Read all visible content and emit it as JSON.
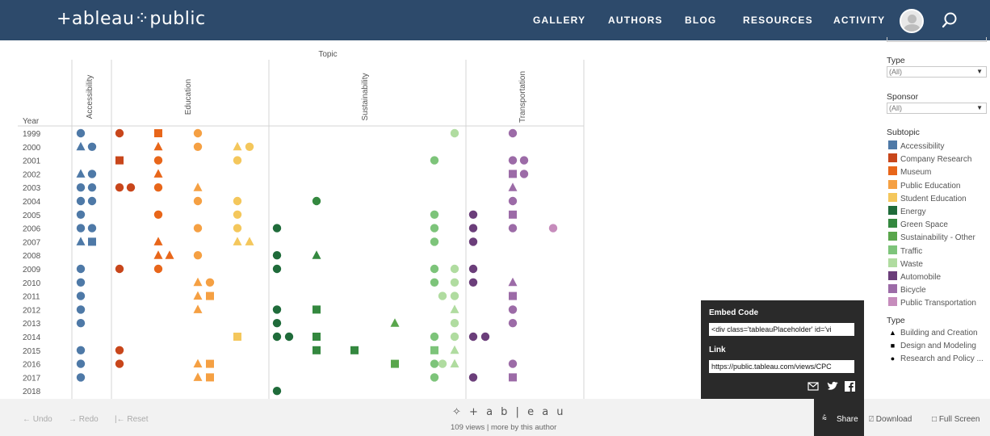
{
  "nav": {
    "logo": "+ableau⁘public",
    "items": [
      "GALLERY",
      "AUTHORS",
      "BLOG",
      "RESOURCES",
      "ACTIVITY"
    ]
  },
  "chart_data": {
    "type": "scatter",
    "title": "Topic",
    "row_header": "Year",
    "years": [
      "1999",
      "2000",
      "2001",
      "2002",
      "2003",
      "2004",
      "2005",
      "2006",
      "2007",
      "2008",
      "2009",
      "2010",
      "2011",
      "2012",
      "2013",
      "2014",
      "2015",
      "2016",
      "2017",
      "2018"
    ],
    "topics": [
      "Accessibility",
      "Education",
      "Sustainability",
      "Transportation"
    ],
    "subtopic_colors": {
      "Accessibility": "#4e79a7",
      "Company Research": "#c8461b",
      "Museum": "#e8661a",
      "Public Education": "#f5a043",
      "Student Education": "#f4c75c",
      "Energy": "#1f6b3a",
      "Green Space": "#34883f",
      "Sustainability - Other": "#59a64c",
      "Traffic": "#7dc47a",
      "Waste": "#b0dca0",
      "Automobile": "#6b3e7a",
      "Bicycle": "#9c6ba7",
      "Public Transportation": "#c68cbc"
    },
    "marks": [
      {
        "year": "1999",
        "subtopic": "Accessibility",
        "type": "circle",
        "col": 0
      },
      {
        "year": "2000",
        "subtopic": "Accessibility",
        "type": "triangle",
        "col": 0
      },
      {
        "year": "2000",
        "subtopic": "Accessibility",
        "type": "circle",
        "col": 1
      },
      {
        "year": "2002",
        "subtopic": "Accessibility",
        "type": "triangle",
        "col": 0
      },
      {
        "year": "2002",
        "subtopic": "Accessibility",
        "type": "circle",
        "col": 1
      },
      {
        "year": "2003",
        "subtopic": "Accessibility",
        "type": "circle",
        "col": 0
      },
      {
        "year": "2003",
        "subtopic": "Accessibility",
        "type": "circle",
        "col": 1
      },
      {
        "year": "2004",
        "subtopic": "Accessibility",
        "type": "circle",
        "col": 0
      },
      {
        "year": "2004",
        "subtopic": "Accessibility",
        "type": "circle",
        "col": 1
      },
      {
        "year": "2005",
        "subtopic": "Accessibility",
        "type": "circle",
        "col": 0
      },
      {
        "year": "2006",
        "subtopic": "Accessibility",
        "type": "circle",
        "col": 0
      },
      {
        "year": "2006",
        "subtopic": "Accessibility",
        "type": "circle",
        "col": 1
      },
      {
        "year": "2007",
        "subtopic": "Accessibility",
        "type": "triangle",
        "col": 0
      },
      {
        "year": "2007",
        "subtopic": "Accessibility",
        "type": "square",
        "col": 1
      },
      {
        "year": "2009",
        "subtopic": "Accessibility",
        "type": "circle",
        "col": 0
      },
      {
        "year": "2010",
        "subtopic": "Accessibility",
        "type": "circle",
        "col": 0
      },
      {
        "year": "2011",
        "subtopic": "Accessibility",
        "type": "circle",
        "col": 0
      },
      {
        "year": "2012",
        "subtopic": "Accessibility",
        "type": "circle",
        "col": 0
      },
      {
        "year": "2013",
        "subtopic": "Accessibility",
        "type": "circle",
        "col": 0
      },
      {
        "year": "2015",
        "subtopic": "Accessibility",
        "type": "circle",
        "col": 0
      },
      {
        "year": "2016",
        "subtopic": "Accessibility",
        "type": "circle",
        "col": 0
      },
      {
        "year": "2017",
        "subtopic": "Accessibility",
        "type": "circle",
        "col": 0
      },
      {
        "year": "1999",
        "subtopic": "Company Research",
        "type": "circle",
        "col": 2
      },
      {
        "year": "2001",
        "subtopic": "Company Research",
        "type": "square",
        "col": 2
      },
      {
        "year": "2003",
        "subtopic": "Company Research",
        "type": "circle",
        "col": 2
      },
      {
        "year": "2003",
        "subtopic": "Company Research",
        "type": "circle",
        "col": 3
      },
      {
        "year": "2009",
        "subtopic": "Company Research",
        "type": "circle",
        "col": 2
      },
      {
        "year": "2015",
        "subtopic": "Company Research",
        "type": "circle",
        "col": 2
      },
      {
        "year": "2016",
        "subtopic": "Company Research",
        "type": "circle",
        "col": 2
      },
      {
        "year": "1999",
        "subtopic": "Museum",
        "type": "square",
        "col": 4
      },
      {
        "year": "2000",
        "subtopic": "Museum",
        "type": "triangle",
        "col": 4
      },
      {
        "year": "2001",
        "subtopic": "Museum",
        "type": "circle",
        "col": 4
      },
      {
        "year": "2002",
        "subtopic": "Museum",
        "type": "triangle",
        "col": 4
      },
      {
        "year": "2003",
        "subtopic": "Museum",
        "type": "circle",
        "col": 4
      },
      {
        "year": "2005",
        "subtopic": "Museum",
        "type": "circle",
        "col": 4
      },
      {
        "year": "2007",
        "subtopic": "Museum",
        "type": "triangle",
        "col": 4
      },
      {
        "year": "2008",
        "subtopic": "Museum",
        "type": "triangle",
        "col": 4
      },
      {
        "year": "2008",
        "subtopic": "Museum",
        "type": "triangle",
        "col": 5
      },
      {
        "year": "2009",
        "subtopic": "Museum",
        "type": "circle",
        "col": 4
      },
      {
        "year": "1999",
        "subtopic": "Public Education",
        "type": "circle",
        "col": 6
      },
      {
        "year": "2000",
        "subtopic": "Public Education",
        "type": "circle",
        "col": 6
      },
      {
        "year": "2003",
        "subtopic": "Public Education",
        "type": "triangle",
        "col": 6
      },
      {
        "year": "2004",
        "subtopic": "Public Education",
        "type": "circle",
        "col": 6
      },
      {
        "year": "2006",
        "subtopic": "Public Education",
        "type": "circle",
        "col": 6
      },
      {
        "year": "2008",
        "subtopic": "Public Education",
        "type": "circle",
        "col": 6
      },
      {
        "year": "2010",
        "subtopic": "Public Education",
        "type": "triangle",
        "col": 6
      },
      {
        "year": "2010",
        "subtopic": "Public Education",
        "type": "circle",
        "col": 7
      },
      {
        "year": "2011",
        "subtopic": "Public Education",
        "type": "triangle",
        "col": 6
      },
      {
        "year": "2011",
        "subtopic": "Public Education",
        "type": "square",
        "col": 7
      },
      {
        "year": "2012",
        "subtopic": "Public Education",
        "type": "triangle",
        "col": 6
      },
      {
        "year": "2016",
        "subtopic": "Public Education",
        "type": "triangle",
        "col": 6
      },
      {
        "year": "2016",
        "subtopic": "Public Education",
        "type": "square",
        "col": 7
      },
      {
        "year": "2017",
        "subtopic": "Public Education",
        "type": "triangle",
        "col": 6
      },
      {
        "year": "2017",
        "subtopic": "Public Education",
        "type": "square",
        "col": 7
      },
      {
        "year": "2000",
        "subtopic": "Student Education",
        "type": "triangle",
        "col": 8
      },
      {
        "year": "2000",
        "subtopic": "Student Education",
        "type": "circle",
        "col": 9
      },
      {
        "year": "2001",
        "subtopic": "Student Education",
        "type": "circle",
        "col": 8
      },
      {
        "year": "2004",
        "subtopic": "Student Education",
        "type": "circle",
        "col": 8
      },
      {
        "year": "2005",
        "subtopic": "Student Education",
        "type": "circle",
        "col": 8
      },
      {
        "year": "2006",
        "subtopic": "Student Education",
        "type": "circle",
        "col": 8
      },
      {
        "year": "2007",
        "subtopic": "Student Education",
        "type": "triangle",
        "col": 8
      },
      {
        "year": "2007",
        "subtopic": "Student Education",
        "type": "triangle",
        "col": 9
      },
      {
        "year": "2014",
        "subtopic": "Student Education",
        "type": "square",
        "col": 8
      },
      {
        "year": "2006",
        "subtopic": "Energy",
        "type": "circle",
        "col": 10
      },
      {
        "year": "2008",
        "subtopic": "Energy",
        "type": "circle",
        "col": 10
      },
      {
        "year": "2009",
        "subtopic": "Energy",
        "type": "circle",
        "col": 10
      },
      {
        "year": "2012",
        "subtopic": "Energy",
        "type": "circle",
        "col": 10
      },
      {
        "year": "2013",
        "subtopic": "Energy",
        "type": "circle",
        "col": 10
      },
      {
        "year": "2014",
        "subtopic": "Energy",
        "type": "circle",
        "col": 10
      },
      {
        "year": "2014",
        "subtopic": "Energy",
        "type": "circle",
        "col": 11
      },
      {
        "year": "2018",
        "subtopic": "Energy",
        "type": "circle",
        "col": 10
      },
      {
        "year": "2004",
        "subtopic": "Green Space",
        "type": "circle",
        "col": 12
      },
      {
        "year": "2008",
        "subtopic": "Green Space",
        "type": "triangle",
        "col": 12
      },
      {
        "year": "2012",
        "subtopic": "Green Space",
        "type": "square",
        "col": 12
      },
      {
        "year": "2014",
        "subtopic": "Green Space",
        "type": "square",
        "col": 12
      },
      {
        "year": "2015",
        "subtopic": "Green Space",
        "type": "square",
        "col": 12
      },
      {
        "year": "2015",
        "subtopic": "Green Space",
        "type": "square",
        "col": 13
      },
      {
        "year": "2013",
        "subtopic": "Sustainability - Other",
        "type": "triangle",
        "col": 14
      },
      {
        "year": "2016",
        "subtopic": "Sustainability - Other",
        "type": "square",
        "col": 14
      },
      {
        "year": "2001",
        "subtopic": "Traffic",
        "type": "circle",
        "col": 15
      },
      {
        "year": "2005",
        "subtopic": "Traffic",
        "type": "circle",
        "col": 15
      },
      {
        "year": "2006",
        "subtopic": "Traffic",
        "type": "circle",
        "col": 15
      },
      {
        "year": "2007",
        "subtopic": "Traffic",
        "type": "circle",
        "col": 15
      },
      {
        "year": "2009",
        "subtopic": "Traffic",
        "type": "circle",
        "col": 15
      },
      {
        "year": "2010",
        "subtopic": "Traffic",
        "type": "circle",
        "col": 15
      },
      {
        "year": "2014",
        "subtopic": "Traffic",
        "type": "circle",
        "col": 15
      },
      {
        "year": "2015",
        "subtopic": "Traffic",
        "type": "square",
        "col": 15
      },
      {
        "year": "2016",
        "subtopic": "Traffic",
        "type": "circle",
        "col": 15
      },
      {
        "year": "2017",
        "subtopic": "Traffic",
        "type": "circle",
        "col": 15
      },
      {
        "year": "1999",
        "subtopic": "Waste",
        "type": "circle",
        "col": 16
      },
      {
        "year": "2009",
        "subtopic": "Waste",
        "type": "circle",
        "col": 16
      },
      {
        "year": "2010",
        "subtopic": "Waste",
        "type": "circle",
        "col": 16
      },
      {
        "year": "2011",
        "subtopic": "Waste",
        "type": "circle",
        "col": 16
      },
      {
        "year": "2011",
        "subtopic": "Waste",
        "type": "circle",
        "col": 17
      },
      {
        "year": "2012",
        "subtopic": "Waste",
        "type": "triangle",
        "col": 16
      },
      {
        "year": "2013",
        "subtopic": "Waste",
        "type": "circle",
        "col": 16
      },
      {
        "year": "2014",
        "subtopic": "Waste",
        "type": "circle",
        "col": 16
      },
      {
        "year": "2015",
        "subtopic": "Waste",
        "type": "triangle",
        "col": 16
      },
      {
        "year": "2016",
        "subtopic": "Waste",
        "type": "triangle",
        "col": 16
      },
      {
        "year": "2016",
        "subtopic": "Waste",
        "type": "circle",
        "col": 17
      },
      {
        "year": "2005",
        "subtopic": "Automobile",
        "type": "circle",
        "col": 18
      },
      {
        "year": "2006",
        "subtopic": "Automobile",
        "type": "circle",
        "col": 18
      },
      {
        "year": "2007",
        "subtopic": "Automobile",
        "type": "circle",
        "col": 18
      },
      {
        "year": "2009",
        "subtopic": "Automobile",
        "type": "circle",
        "col": 18
      },
      {
        "year": "2010",
        "subtopic": "Automobile",
        "type": "circle",
        "col": 18
      },
      {
        "year": "2014",
        "subtopic": "Automobile",
        "type": "circle",
        "col": 18
      },
      {
        "year": "2014",
        "subtopic": "Automobile",
        "type": "circle",
        "col": 19
      },
      {
        "year": "2017",
        "subtopic": "Automobile",
        "type": "circle",
        "col": 18
      },
      {
        "year": "1999",
        "subtopic": "Bicycle",
        "type": "circle",
        "col": 20
      },
      {
        "year": "2001",
        "subtopic": "Bicycle",
        "type": "circle",
        "col": 20
      },
      {
        "year": "2001",
        "subtopic": "Bicycle",
        "type": "circle",
        "col": 21
      },
      {
        "year": "2002",
        "subtopic": "Bicycle",
        "type": "square",
        "col": 20
      },
      {
        "year": "2002",
        "subtopic": "Bicycle",
        "type": "circle",
        "col": 21
      },
      {
        "year": "2003",
        "subtopic": "Bicycle",
        "type": "triangle",
        "col": 20
      },
      {
        "year": "2004",
        "subtopic": "Bicycle",
        "type": "circle",
        "col": 20
      },
      {
        "year": "2005",
        "subtopic": "Bicycle",
        "type": "square",
        "col": 20
      },
      {
        "year": "2006",
        "subtopic": "Bicycle",
        "type": "circle",
        "col": 20
      },
      {
        "year": "2010",
        "subtopic": "Bicycle",
        "type": "triangle",
        "col": 20
      },
      {
        "year": "2011",
        "subtopic": "Bicycle",
        "type": "square",
        "col": 20
      },
      {
        "year": "2012",
        "subtopic": "Bicycle",
        "type": "circle",
        "col": 20
      },
      {
        "year": "2013",
        "subtopic": "Bicycle",
        "type": "circle",
        "col": 20
      },
      {
        "year": "2016",
        "subtopic": "Bicycle",
        "type": "circle",
        "col": 20
      },
      {
        "year": "2017",
        "subtopic": "Bicycle",
        "type": "square",
        "col": 20
      },
      {
        "year": "2006",
        "subtopic": "Public Transportation",
        "type": "circle",
        "col": 22
      }
    ]
  },
  "filters": {
    "type_title": "Type",
    "type_value": "(All)",
    "sponsor_title": "Sponsor",
    "sponsor_value": "(All)"
  },
  "legend": {
    "subtopic_title": "Subtopic",
    "subtopics": [
      "Accessibility",
      "Company Research",
      "Museum",
      "Public Education",
      "Student Education",
      "Energy",
      "Green Space",
      "Sustainability - Other",
      "Traffic",
      "Waste",
      "Automobile",
      "Bicycle",
      "Public Transportation"
    ],
    "type_title": "Type",
    "types": [
      {
        "label": "Building and Creation",
        "shape": "▲"
      },
      {
        "label": "Design and Modeling",
        "shape": "■"
      },
      {
        "label": "Research and Policy ...",
        "shape": "●"
      }
    ]
  },
  "share": {
    "embed_label": "Embed Code",
    "embed_value": "<div class='tableauPlaceholder' id='vi",
    "link_label": "Link",
    "link_value": "https://public.tableau.com/views/CPC"
  },
  "toolbar": {
    "undo": "Undo",
    "redo": "Redo",
    "reset": "Reset",
    "share": "Share",
    "download": "Download",
    "fullscreen": "Full Screen",
    "brand": "+ a b | e a u",
    "views": "109 views | more by this author"
  }
}
